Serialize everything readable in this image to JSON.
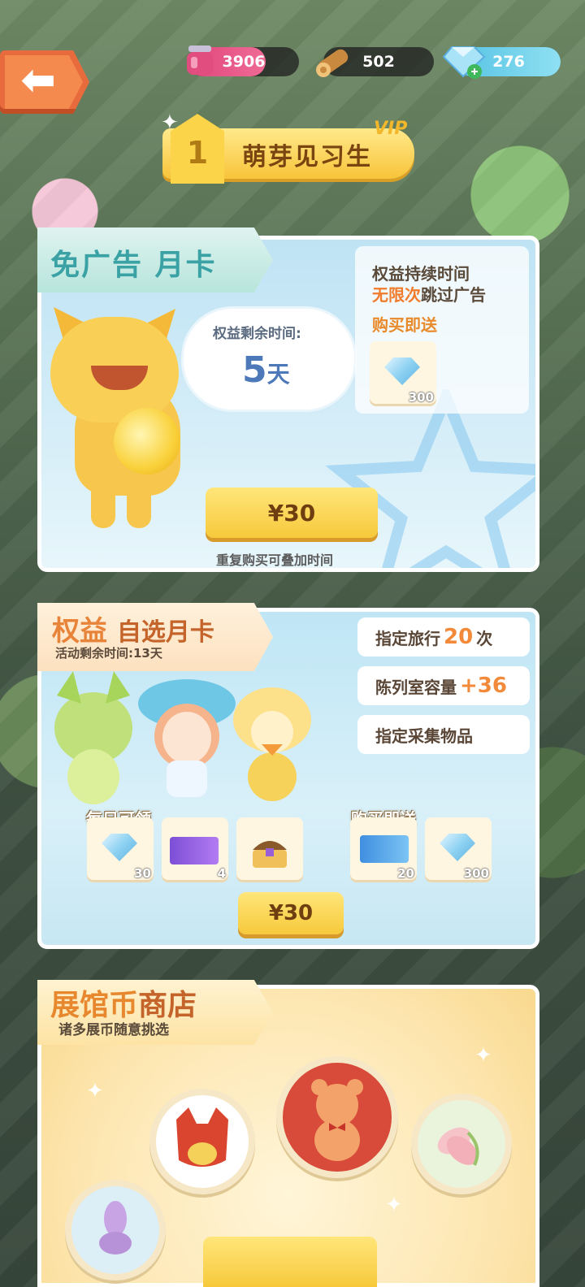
{
  "resources": {
    "jam": "3906",
    "wood": "502",
    "gems": "276"
  },
  "vip": {
    "level": "1",
    "title": "萌芽见习生",
    "tag": "VIP"
  },
  "ad_free_card": {
    "title": "免广告 月卡",
    "remaining_label": "权益剩余时间:",
    "remaining_value": "5",
    "remaining_unit": "天",
    "benefit_line1": "权益持续时间",
    "benefit_highlight": "无限次",
    "benefit_line2_rest": "跳过广告",
    "bonus_label": "购买即送",
    "bonus_item_count": "300",
    "price": "¥30",
    "note": "重复购买可叠加时间"
  },
  "custom_card": {
    "title_a": "权益",
    "title_b": "自选月卡",
    "subtitle": "活动剩余时间:13天",
    "perks": [
      {
        "prefix": "指定旅行",
        "num": "20",
        "suffix": "次"
      },
      {
        "prefix": "陈列室容量",
        "num": "+36",
        "suffix": ""
      },
      {
        "prefix": "指定采集物品",
        "num": "",
        "suffix": ""
      }
    ],
    "daily_label": "每日可领",
    "daily_items": [
      {
        "icon": "gem-icon",
        "count": "30"
      },
      {
        "icon": "ticket-purple-icon",
        "count": "4"
      },
      {
        "icon": "chest-icon",
        "count": ""
      }
    ],
    "bonus_label": "购买即送",
    "bonus_items": [
      {
        "icon": "ticket-blue-icon",
        "count": "20"
      },
      {
        "icon": "gem-icon",
        "count": "300"
      }
    ],
    "price": "¥30"
  },
  "shop": {
    "title_a": "展馆币",
    "title_b": "商店",
    "subtitle": "诸多展币随意挑选"
  },
  "colors": {
    "accent_orange": "#f28a3a",
    "button_yellow": "#f7c93b",
    "gem_blue": "#5aaee0"
  }
}
